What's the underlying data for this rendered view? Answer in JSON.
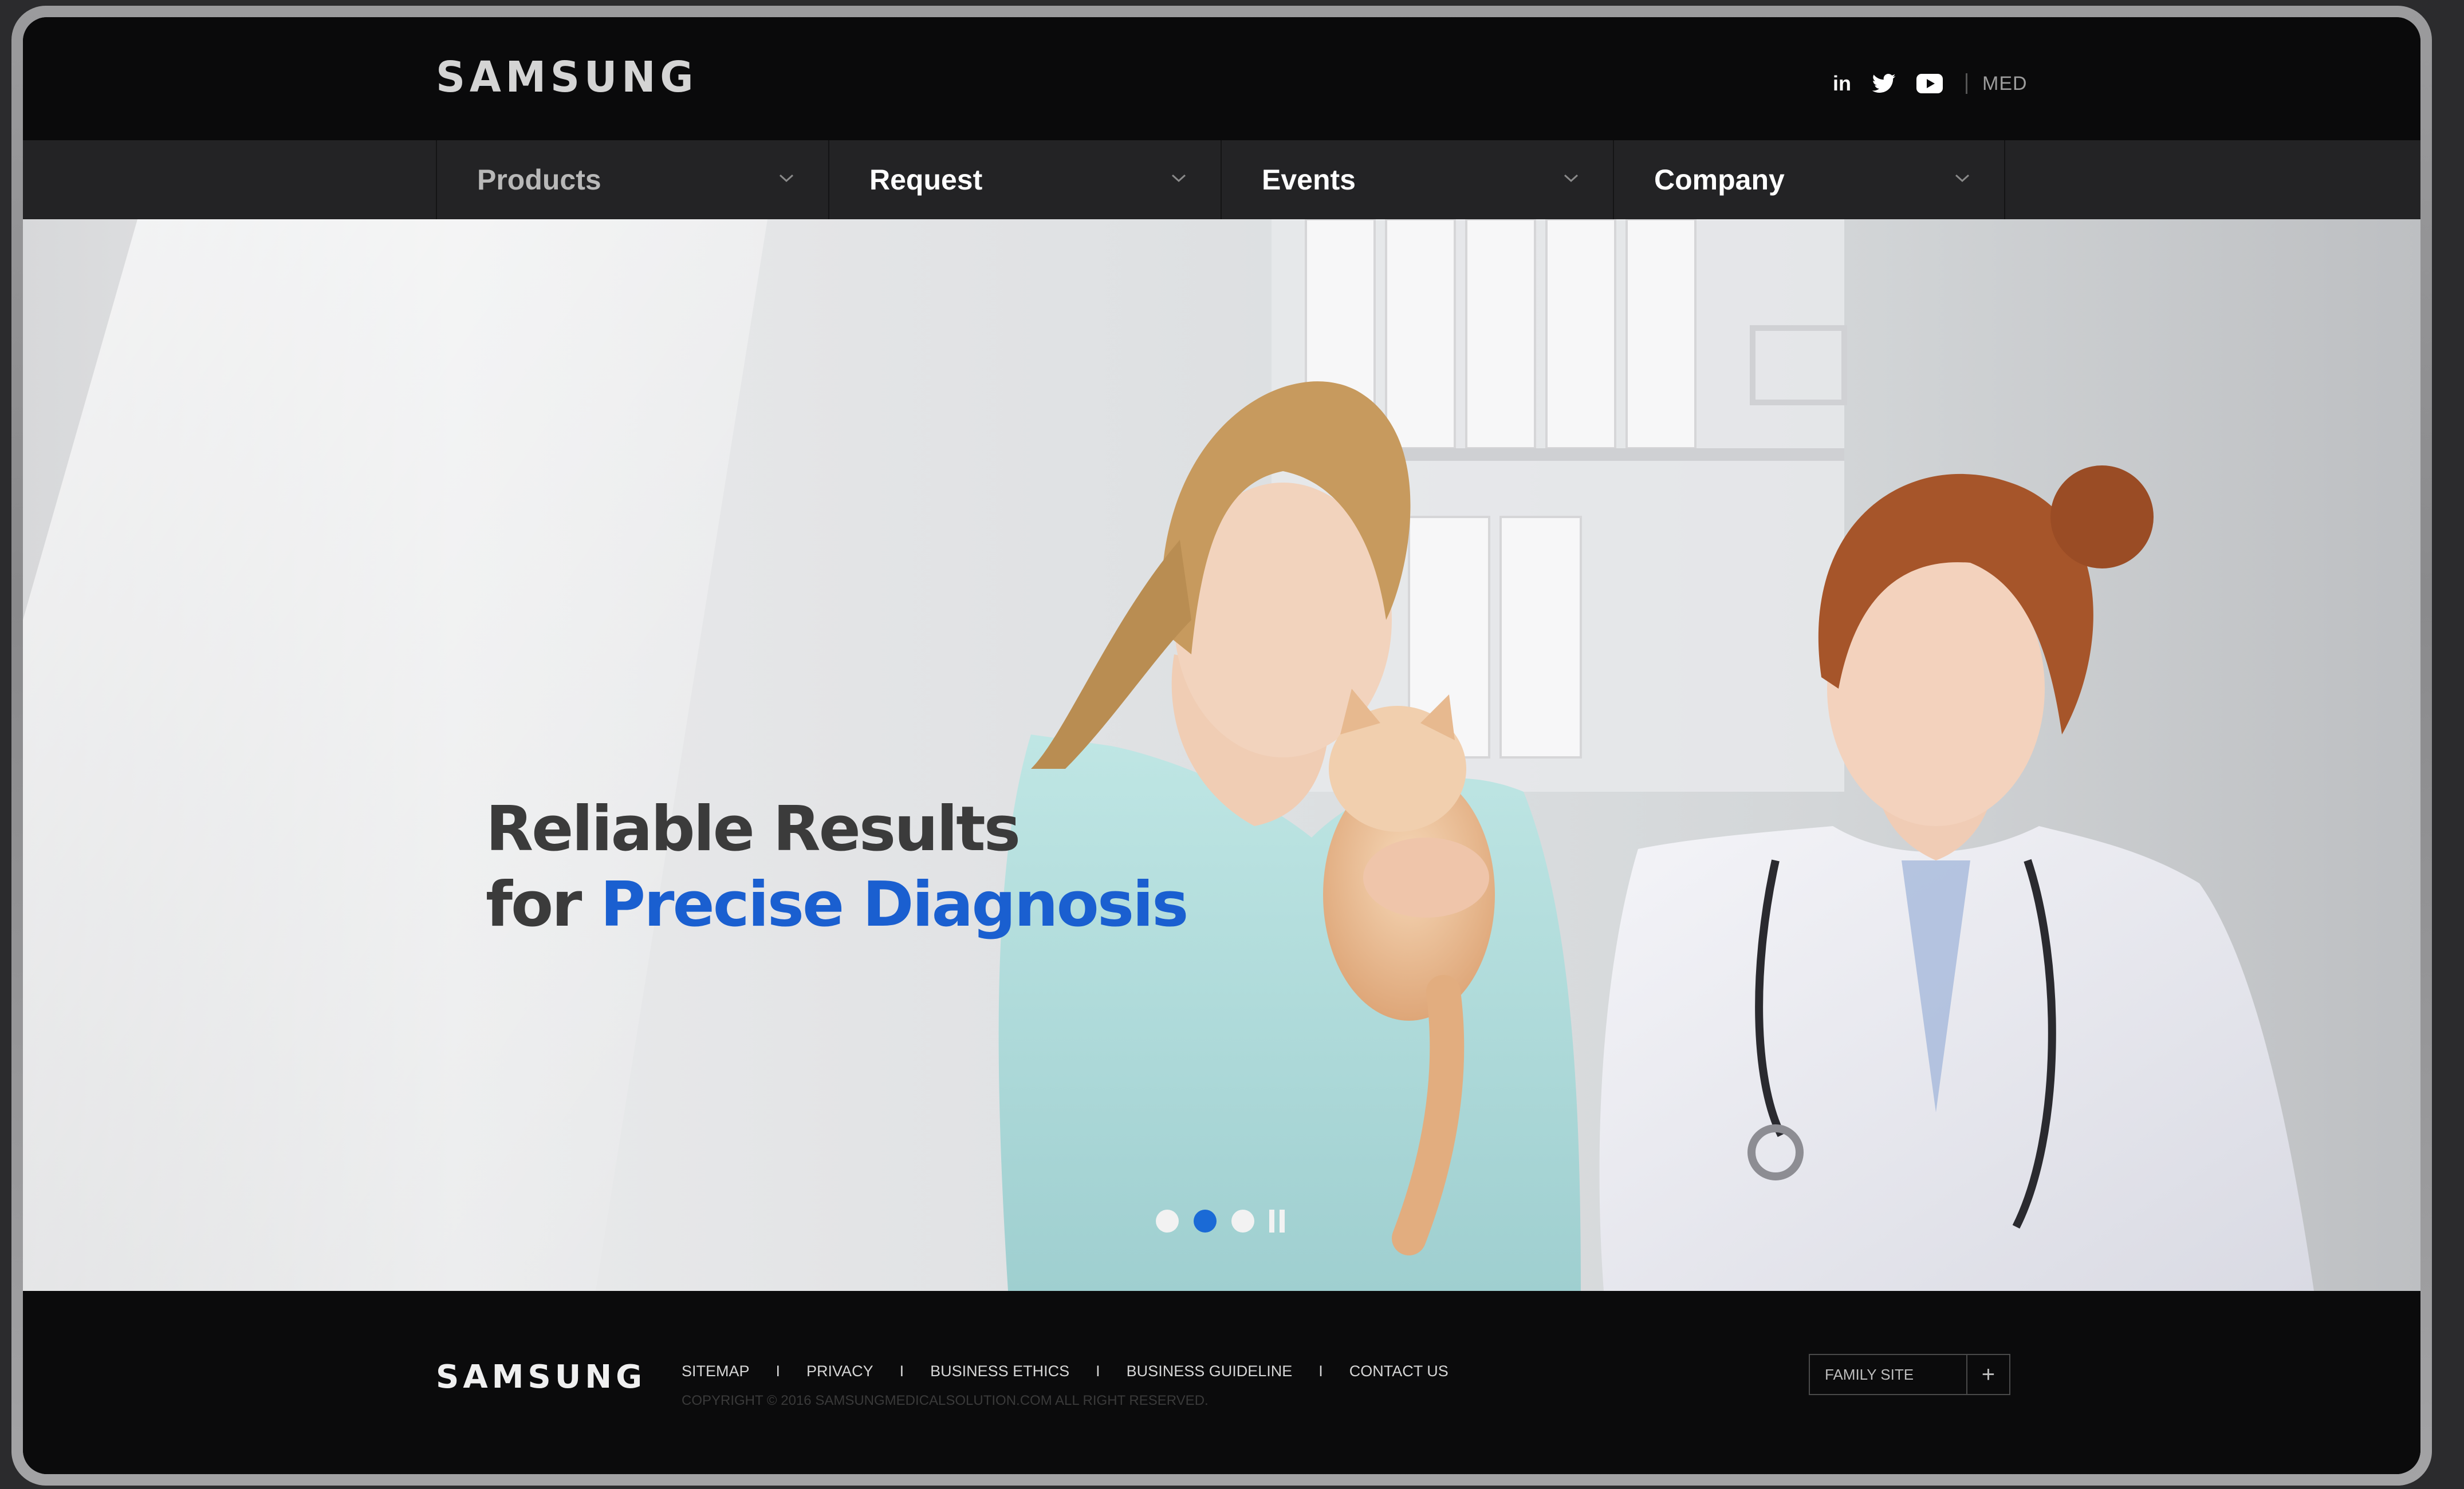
{
  "header": {
    "logo": "SAMSUNG",
    "social": [
      {
        "name": "linkedin-icon",
        "label": "in"
      },
      {
        "name": "twitter-icon"
      },
      {
        "name": "youtube-icon"
      }
    ],
    "region": "MED"
  },
  "nav": {
    "items": [
      {
        "label": "Products",
        "color": "#b8b8b8"
      },
      {
        "label": "Request",
        "color": "#ffffff"
      },
      {
        "label": "Events",
        "color": "#ffffff"
      },
      {
        "label": "Company",
        "color": "#ffffff"
      }
    ]
  },
  "hero": {
    "headline_line1": "Reliable Results",
    "headline_line2_prefix": "for ",
    "headline_line2_highlight": "Precise Diagnosis",
    "highlight_color": "#1a5fd0",
    "slides": 3,
    "active_slide": 2
  },
  "footer": {
    "logo": "SAMSUNG",
    "links": [
      "SITEMAP",
      "PRIVACY",
      "BUSINESS ETHICS",
      "BUSINESS GUIDELINE",
      "CONTACT US"
    ],
    "separator": "I",
    "copyright": "COPYRIGHT © 2016 SAMSUNGMEDICALSOLUTION.COM ALL RIGHT RESERVED.",
    "family_site": "FAMILY SITE"
  }
}
